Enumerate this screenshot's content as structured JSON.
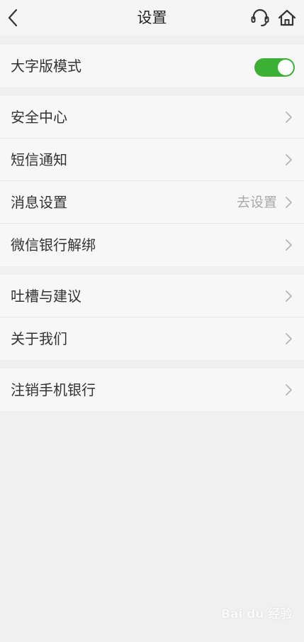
{
  "header": {
    "title": "设置"
  },
  "large_font": {
    "label": "大字版模式",
    "enabled": true
  },
  "group1": [
    {
      "label": "安全中心",
      "value": ""
    },
    {
      "label": "短信通知",
      "value": ""
    },
    {
      "label": "消息设置",
      "value": "去设置"
    },
    {
      "label": "微信银行解绑",
      "value": ""
    }
  ],
  "group2": [
    {
      "label": "吐槽与建议"
    },
    {
      "label": "关于我们"
    }
  ],
  "group3": [
    {
      "label": "注销手机银行"
    }
  ],
  "watermark": "Bai du 经验",
  "colors": {
    "toggle_on": "#3cb034",
    "background": "#f0f0f0"
  }
}
